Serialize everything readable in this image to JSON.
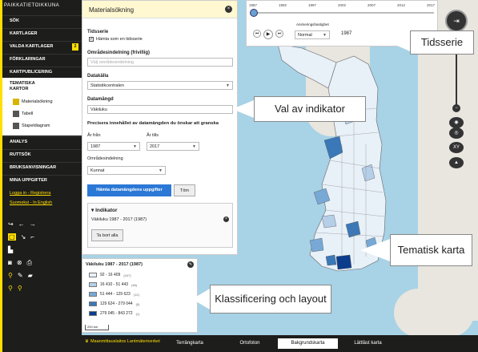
{
  "brand": "PAIKKATIETOIKKUNA",
  "sidebar": {
    "items": [
      {
        "label": "SÖK"
      },
      {
        "label": "KARTLAGER"
      },
      {
        "label": "VALDA KARTLAGER",
        "badge": "2"
      },
      {
        "label": "FÖRKLARINGAR"
      },
      {
        "label": "KARTPUBLICERING"
      }
    ],
    "thematic": {
      "title": "TEMATISKA KARTOR",
      "items": [
        {
          "label": "Materialsökning"
        },
        {
          "label": "Tabell"
        },
        {
          "label": "Stapeldiagram"
        }
      ]
    },
    "items2": [
      {
        "label": "ANALYS"
      },
      {
        "label": "RUTTSÖK"
      },
      {
        "label": "BRUKSANVISNINGAR"
      },
      {
        "label": "MINA UPPGIFTER"
      }
    ],
    "login": "Logga in",
    "register": "Registrera",
    "lang1": "Suomeksi",
    "lang2": "In English",
    "sep": "-"
  },
  "panel": {
    "title": "Materialsökning",
    "tidsserie_label": "Tidsserie",
    "checkbox_label": "Hämta som en tidsserie",
    "omradesindelning_label": "Områdesindelning (frivillig)",
    "omradesindelning_placeholder": "Välj områdesindelning",
    "datakalla_label": "Datakälla",
    "datakalla_value": "Statistikcentralen",
    "datamangd_label": "Datamängd",
    "datamangd_value": "Väkiluku",
    "precisera": "Precisera innehållet av datamängden du önskar att granska",
    "ar_fran_label": "År från",
    "ar_fran_value": "1987",
    "ar_tills_label": "År tills",
    "ar_tills_value": "2017",
    "omradesindelning2_label": "Områdesindelning",
    "omradesindelning2_value": "Kunnat",
    "fetch_button": "Hämta datamängdens uppgifter",
    "clear_button": "Töm",
    "indikator_title": "Indikator",
    "indikator_item": "Väkiluku 1987 - 2017 (1987)",
    "remove_all_button": "Ta bort alla"
  },
  "timeseries": {
    "ticks": [
      "1987",
      "1992",
      "1997",
      "2002",
      "2007",
      "2012",
      "2017"
    ],
    "animation_label": "Animeringshastighet",
    "speed_value": "Normal",
    "current_year": "1987"
  },
  "legend": {
    "title": "Väkiluku 1987 - 2017 (1987)",
    "rows": [
      {
        "label": "92 - 16 409",
        "count": "(247)",
        "color": "#eaf1fa"
      },
      {
        "label": "16 410 - 51 443",
        "count": "(46)",
        "color": "#b5cfe8"
      },
      {
        "label": "51 444 - 129 623",
        "count": "(12)",
        "color": "#77a8d6"
      },
      {
        "label": "129 624 - 279 044",
        "count": "(5)",
        "color": "#3a78b8"
      },
      {
        "label": "279 045 - 843 272",
        "count": "(1)",
        "color": "#0b3d8c"
      }
    ],
    "scale": "200 km"
  },
  "bottombar": {
    "brand": "Maanmittauslaitos Lantmäteriverket",
    "tabs": [
      {
        "label": "Terrängkarta",
        "active": false
      },
      {
        "label": "Ortofoton",
        "active": false
      },
      {
        "label": "Bakgrundskarta",
        "active": true
      },
      {
        "label": "Lättläst karta",
        "active": false
      }
    ]
  },
  "callouts": {
    "tidsserie": "Tidsserie",
    "val_av_indikator": "Val av indikator",
    "tematisk_karta": "Tematisk karta",
    "klassificering": "Klassificering och layout"
  },
  "controls": {
    "xy": "XY"
  }
}
